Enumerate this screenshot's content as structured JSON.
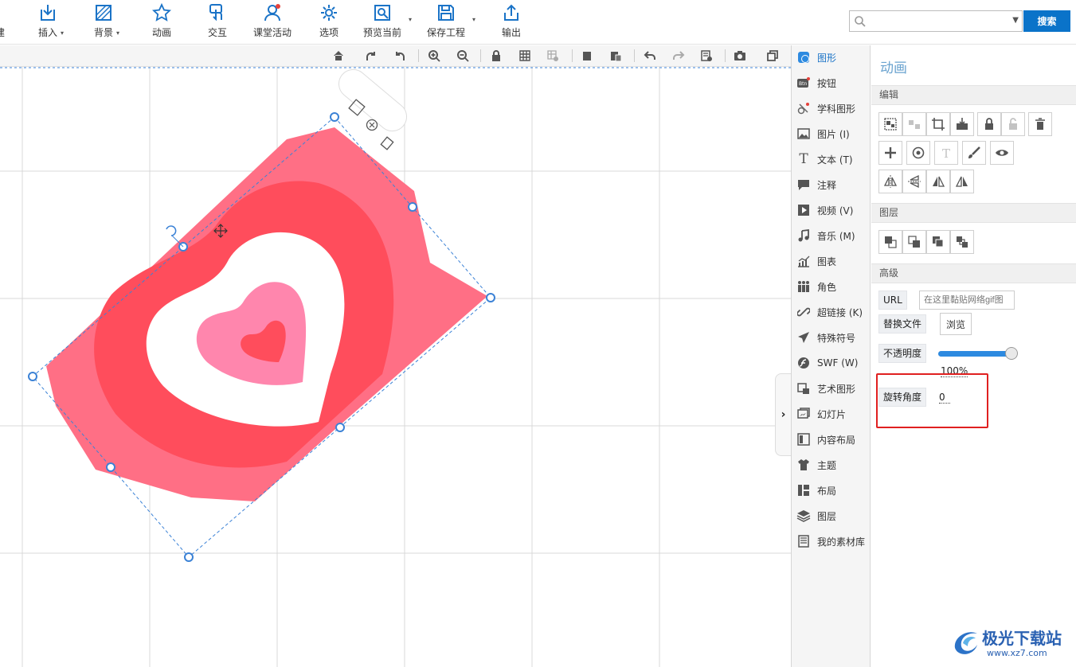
{
  "toolbar": {
    "items": [
      {
        "label": "建"
      },
      {
        "label": "插入"
      },
      {
        "label": "背景"
      },
      {
        "label": "动画"
      },
      {
        "label": "交互"
      },
      {
        "label": "课堂活动"
      },
      {
        "label": "选项"
      },
      {
        "label": "预览当前"
      },
      {
        "label": "保存工程"
      },
      {
        "label": "输出"
      }
    ],
    "search": {
      "value": "",
      "button_label": "搜索"
    }
  },
  "shape_list": {
    "items": [
      {
        "label": "图形",
        "icon": "shape-icon",
        "active": true
      },
      {
        "label": "按钮",
        "icon": "button-icon"
      },
      {
        "label": "学科图形",
        "icon": "subject-shape-icon"
      },
      {
        "label": "图片 (I)",
        "icon": "image-icon"
      },
      {
        "label": "文本 (T)",
        "icon": "text-icon"
      },
      {
        "label": "注释",
        "icon": "comment-icon"
      },
      {
        "label": "视频 (V)",
        "icon": "video-icon"
      },
      {
        "label": "音乐 (M)",
        "icon": "music-icon"
      },
      {
        "label": "图表",
        "icon": "chart-icon"
      },
      {
        "label": "角色",
        "icon": "role-icon"
      },
      {
        "label": "超链接 (K)",
        "icon": "link-icon"
      },
      {
        "label": "特殊符号",
        "icon": "plane-icon"
      },
      {
        "label": "SWF (W)",
        "icon": "flash-icon"
      },
      {
        "label": "艺术图形",
        "icon": "art-shape-icon"
      },
      {
        "label": "幻灯片",
        "icon": "slides-icon"
      },
      {
        "label": "内容布局",
        "icon": "content-layout-icon"
      },
      {
        "label": "主题",
        "icon": "theme-shirt-icon"
      },
      {
        "label": "布局",
        "icon": "layout-icon"
      },
      {
        "label": "图层",
        "icon": "layers-icon"
      },
      {
        "label": "我的素材库",
        "icon": "library-icon"
      }
    ]
  },
  "props": {
    "title": "动画",
    "edit_label": "编辑",
    "layer_label": "图层",
    "advanced_label": "高级",
    "url_label": "URL",
    "url_placeholder": "在这里黏贴网络gif图",
    "replace_label": "替换文件",
    "browse_label": "浏览",
    "opacity_label": "不透明度",
    "opacity_value": "100%",
    "opacity_fraction": 1.0,
    "rotation_label": "旋转角度",
    "rotation_value": "0"
  },
  "watermark": {
    "text": "极光下载站",
    "url": "www.xz7.com"
  },
  "colors": {
    "accent": "#0a73c9",
    "heart_outer": "#ff6f85",
    "heart_mid": "#ff4d5c",
    "heart_pink": "#ff86ad",
    "highlight_box": "#e02020"
  }
}
